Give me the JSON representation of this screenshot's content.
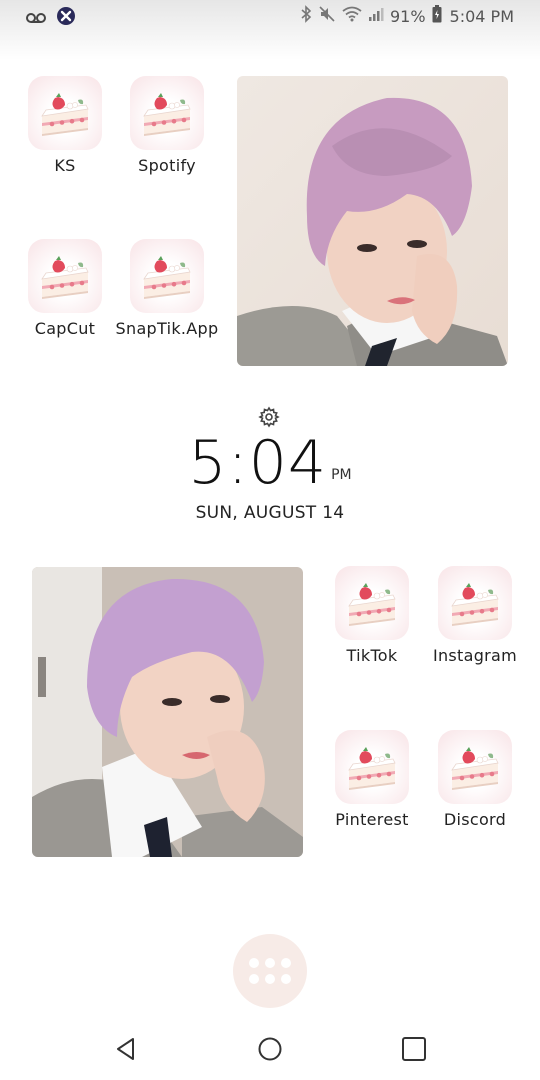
{
  "status_bar": {
    "battery_percent": "91%",
    "time": "5:04 PM"
  },
  "apps_top": [
    {
      "label": "KS"
    },
    {
      "label": "Spotify"
    },
    {
      "label": "CapCut"
    },
    {
      "label": "SnapTik.App"
    }
  ],
  "apps_bottom": [
    {
      "label": "TikTok"
    },
    {
      "label": "Instagram"
    },
    {
      "label": "Pinterest"
    },
    {
      "label": "Discord"
    }
  ],
  "clock": {
    "time": "5:04",
    "ampm": "PM",
    "date": "SUN, AUGUST 14"
  },
  "icons": {
    "app_icon": "strawberry-cake-icon",
    "settings": "gear-icon",
    "voicemail": "voicemail-icon",
    "notification": "app-notification-icon",
    "bluetooth": "bluetooth-icon",
    "mute": "mute-icon",
    "wifi": "wifi-icon",
    "signal": "signal-icon",
    "battery": "battery-icon",
    "back": "back-icon",
    "home": "home-icon",
    "recents": "recents-icon",
    "app_drawer": "app-drawer-icon"
  },
  "colors": {
    "icon_bg": "#f8e3e6",
    "drawer_bg": "#f7ebe7",
    "hair": "#c79bc0"
  }
}
